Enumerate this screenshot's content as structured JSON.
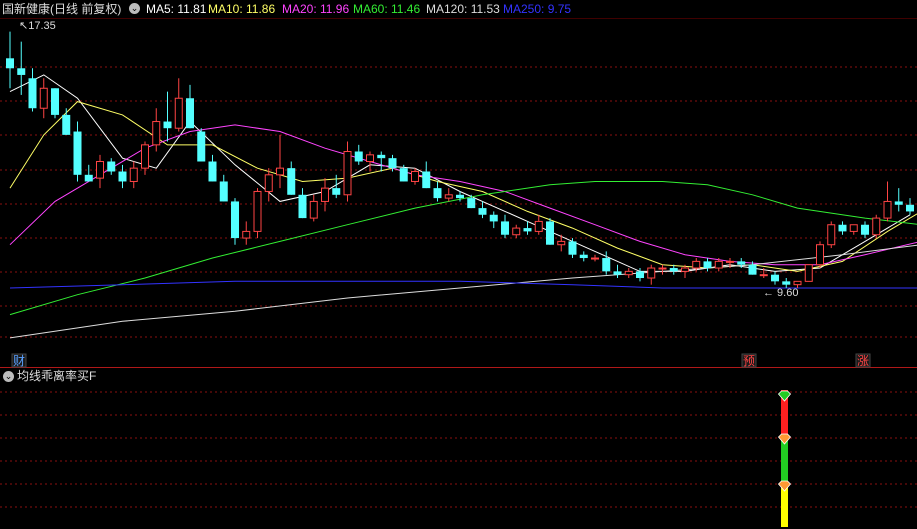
{
  "header": {
    "stock_title": "国新健康(日线 前复权)",
    "indicators": [
      {
        "label": "MA5: 11.81",
        "color": "#ffffff"
      },
      {
        "label": "MA10: 11.86",
        "color": "#ffff66"
      },
      {
        "label": "MA20: 11.96",
        "color": "#ff44ff"
      },
      {
        "label": "MA60: 11.46",
        "color": "#33ee33"
      },
      {
        "label": "MA120: 11.53",
        "color": "#dddddd"
      },
      {
        "label": "MA250: 9.75",
        "color": "#3333ff"
      }
    ]
  },
  "price_chart": {
    "high_label": "17.35",
    "low_label": "9.60",
    "markers": [
      {
        "text": "财",
        "color": "#5aa0ff"
      },
      {
        "text": "预",
        "color": "#ff4444"
      },
      {
        "text": "涨",
        "color": "#ff4444"
      }
    ]
  },
  "sub_panel": {
    "title": "均线乖离率买F",
    "bar_colors": [
      "#ff2020",
      "#22cc22",
      "#ffff00"
    ]
  },
  "colors": {
    "up": "#ff4444",
    "down": "#54ffff",
    "grid": "#8a1010",
    "background": "#000000"
  },
  "chart_data": {
    "type": "candlestick",
    "price_max": 17.35,
    "price_min": 9.6,
    "candles": [
      [
        16.5,
        17.3,
        15.6,
        16.2
      ],
      [
        16.2,
        17.0,
        15.4,
        16.0
      ],
      [
        15.9,
        16.2,
        14.9,
        15.0
      ],
      [
        15.0,
        15.9,
        14.7,
        15.6
      ],
      [
        15.6,
        15.6,
        14.7,
        14.8
      ],
      [
        14.8,
        15.0,
        14.2,
        14.2
      ],
      [
        14.3,
        14.6,
        12.8,
        13.0
      ],
      [
        13.0,
        13.3,
        12.8,
        12.8
      ],
      [
        12.9,
        13.6,
        12.6,
        13.4
      ],
      [
        13.4,
        13.5,
        13.0,
        13.1
      ],
      [
        13.1,
        13.3,
        12.6,
        12.8
      ],
      [
        12.8,
        13.4,
        12.6,
        13.2
      ],
      [
        13.2,
        14.0,
        13.0,
        13.9
      ],
      [
        13.9,
        15.0,
        13.7,
        14.6
      ],
      [
        14.6,
        15.5,
        14.0,
        14.4
      ],
      [
        14.4,
        15.9,
        14.3,
        15.3
      ],
      [
        15.3,
        15.7,
        14.4,
        14.4
      ],
      [
        14.3,
        14.4,
        13.4,
        13.4
      ],
      [
        13.4,
        13.6,
        12.8,
        12.8
      ],
      [
        12.8,
        13.0,
        12.2,
        12.2
      ],
      [
        12.2,
        12.3,
        10.9,
        11.1
      ],
      [
        11.1,
        11.6,
        10.9,
        11.3
      ],
      [
        11.3,
        12.6,
        11.1,
        12.5
      ],
      [
        12.5,
        13.2,
        12.2,
        13.0
      ],
      [
        13.0,
        14.2,
        12.6,
        13.2
      ],
      [
        13.2,
        13.4,
        12.4,
        12.4
      ],
      [
        12.4,
        12.6,
        11.7,
        11.7
      ],
      [
        11.7,
        12.4,
        11.6,
        12.2
      ],
      [
        12.2,
        12.9,
        11.9,
        12.6
      ],
      [
        12.6,
        13.0,
        12.3,
        12.4
      ],
      [
        12.4,
        14.0,
        12.2,
        13.7
      ],
      [
        13.7,
        13.9,
        13.3,
        13.4
      ],
      [
        13.4,
        13.7,
        13.1,
        13.6
      ],
      [
        13.6,
        13.7,
        13.1,
        13.5
      ],
      [
        13.5,
        13.6,
        13.1,
        13.2
      ],
      [
        13.2,
        13.3,
        12.8,
        12.8
      ],
      [
        12.8,
        13.2,
        12.7,
        13.1
      ],
      [
        13.1,
        13.4,
        12.6,
        12.6
      ],
      [
        12.6,
        12.8,
        12.2,
        12.3
      ],
      [
        12.3,
        12.6,
        12.2,
        12.4
      ],
      [
        12.4,
        12.5,
        12.2,
        12.3
      ],
      [
        12.3,
        12.4,
        12.0,
        12.0
      ],
      [
        12.0,
        12.2,
        11.7,
        11.8
      ],
      [
        11.8,
        11.9,
        11.4,
        11.6
      ],
      [
        11.6,
        11.8,
        11.1,
        11.2
      ],
      [
        11.2,
        11.5,
        11.1,
        11.4
      ],
      [
        11.4,
        11.6,
        11.2,
        11.3
      ],
      [
        11.3,
        11.8,
        11.2,
        11.6
      ],
      [
        11.6,
        11.7,
        10.9,
        10.9
      ],
      [
        10.9,
        11.2,
        10.7,
        11.0
      ],
      [
        11.0,
        11.1,
        10.5,
        10.6
      ],
      [
        10.6,
        10.7,
        10.4,
        10.5
      ],
      [
        10.5,
        10.6,
        10.4,
        10.5
      ],
      [
        10.5,
        10.7,
        10.0,
        10.1
      ],
      [
        10.1,
        10.3,
        9.9,
        10.0
      ],
      [
        10.0,
        10.2,
        9.9,
        10.1
      ],
      [
        10.1,
        10.2,
        9.8,
        9.9
      ],
      [
        9.9,
        10.3,
        9.7,
        10.2
      ],
      [
        10.2,
        10.3,
        10.0,
        10.2
      ],
      [
        10.2,
        10.3,
        10.0,
        10.1
      ],
      [
        10.1,
        10.3,
        9.9,
        10.2
      ],
      [
        10.2,
        10.5,
        10.1,
        10.4
      ],
      [
        10.4,
        10.5,
        10.1,
        10.2
      ],
      [
        10.2,
        10.5,
        10.1,
        10.4
      ],
      [
        10.4,
        10.5,
        10.2,
        10.4
      ],
      [
        10.4,
        10.5,
        10.2,
        10.3
      ],
      [
        10.3,
        10.4,
        10.0,
        10.0
      ],
      [
        10.0,
        10.2,
        9.9,
        10.0
      ],
      [
        10.0,
        10.1,
        9.7,
        9.8
      ],
      [
        9.8,
        9.9,
        9.6,
        9.7
      ],
      [
        9.7,
        9.8,
        9.6,
        9.8
      ],
      [
        9.8,
        10.3,
        9.8,
        10.3
      ],
      [
        10.3,
        11.0,
        10.2,
        10.9
      ],
      [
        10.9,
        11.6,
        10.8,
        11.5
      ],
      [
        11.5,
        11.6,
        11.2,
        11.3
      ],
      [
        11.3,
        11.5,
        11.2,
        11.5
      ],
      [
        11.5,
        11.6,
        11.1,
        11.2
      ],
      [
        11.2,
        11.8,
        11.1,
        11.7
      ],
      [
        11.7,
        12.8,
        11.6,
        12.2
      ],
      [
        12.2,
        12.6,
        11.9,
        12.1
      ],
      [
        12.1,
        12.3,
        11.8,
        11.9
      ]
    ],
    "ma_series": [
      {
        "name": "MA5",
        "color": "#ffffff",
        "points": [
          [
            0,
            15.5
          ],
          [
            3,
            16.0
          ],
          [
            6,
            15.3
          ],
          [
            10,
            13.5
          ],
          [
            13,
            13.2
          ],
          [
            16,
            14.6
          ],
          [
            20,
            13.3
          ],
          [
            24,
            12.2
          ],
          [
            28,
            12.5
          ],
          [
            32,
            13.3
          ],
          [
            36,
            13.2
          ],
          [
            40,
            12.5
          ],
          [
            44,
            11.9
          ],
          [
            48,
            11.3
          ],
          [
            52,
            10.7
          ],
          [
            56,
            10.1
          ],
          [
            60,
            10.1
          ],
          [
            64,
            10.3
          ],
          [
            68,
            10.1
          ],
          [
            72,
            10.2
          ],
          [
            76,
            11.0
          ],
          [
            80,
            11.8
          ]
        ]
      },
      {
        "name": "MA10",
        "color": "#ffff66",
        "points": [
          [
            0,
            12.6
          ],
          [
            3,
            14.2
          ],
          [
            6,
            15.2
          ],
          [
            10,
            14.8
          ],
          [
            14,
            13.9
          ],
          [
            18,
            13.9
          ],
          [
            22,
            13.2
          ],
          [
            26,
            12.8
          ],
          [
            30,
            12.9
          ],
          [
            34,
            13.2
          ],
          [
            38,
            12.8
          ],
          [
            42,
            12.5
          ],
          [
            46,
            11.9
          ],
          [
            50,
            11.4
          ],
          [
            54,
            10.8
          ],
          [
            58,
            10.3
          ],
          [
            62,
            10.2
          ],
          [
            66,
            10.3
          ],
          [
            70,
            10.1
          ],
          [
            74,
            10.4
          ],
          [
            78,
            11.3
          ],
          [
            81,
            11.9
          ]
        ]
      },
      {
        "name": "MA20",
        "color": "#ff44ff",
        "points": [
          [
            0,
            10.9
          ],
          [
            4,
            12.2
          ],
          [
            8,
            13.0
          ],
          [
            12,
            13.8
          ],
          [
            16,
            14.3
          ],
          [
            20,
            14.5
          ],
          [
            24,
            14.3
          ],
          [
            28,
            13.8
          ],
          [
            32,
            13.4
          ],
          [
            36,
            13.0
          ],
          [
            40,
            12.8
          ],
          [
            44,
            12.5
          ],
          [
            48,
            12.0
          ],
          [
            52,
            11.5
          ],
          [
            56,
            11.0
          ],
          [
            60,
            10.6
          ],
          [
            64,
            10.4
          ],
          [
            68,
            10.3
          ],
          [
            72,
            10.3
          ],
          [
            76,
            10.6
          ],
          [
            81,
            11.0
          ]
        ]
      },
      {
        "name": "MA60",
        "color": "#33ee33",
        "points": [
          [
            0,
            8.8
          ],
          [
            6,
            9.4
          ],
          [
            12,
            9.9
          ],
          [
            18,
            10.5
          ],
          [
            24,
            11.0
          ],
          [
            30,
            11.5
          ],
          [
            36,
            12.0
          ],
          [
            42,
            12.4
          ],
          [
            48,
            12.7
          ],
          [
            52,
            12.8
          ],
          [
            58,
            12.8
          ],
          [
            62,
            12.7
          ],
          [
            66,
            12.4
          ],
          [
            70,
            12.0
          ],
          [
            76,
            11.7
          ],
          [
            81,
            11.5
          ]
        ]
      },
      {
        "name": "MA120",
        "color": "#dddddd",
        "points": [
          [
            0,
            8.1
          ],
          [
            10,
            8.6
          ],
          [
            20,
            8.9
          ],
          [
            30,
            9.3
          ],
          [
            40,
            9.6
          ],
          [
            50,
            9.9
          ],
          [
            58,
            10.1
          ],
          [
            66,
            10.3
          ],
          [
            74,
            10.6
          ],
          [
            81,
            10.9
          ]
        ]
      },
      {
        "name": "MA250",
        "color": "#3333ff",
        "points": [
          [
            0,
            9.6
          ],
          [
            10,
            9.7
          ],
          [
            20,
            9.8
          ],
          [
            30,
            9.8
          ],
          [
            40,
            9.8
          ],
          [
            50,
            9.7
          ],
          [
            58,
            9.6
          ],
          [
            66,
            9.6
          ],
          [
            74,
            9.6
          ],
          [
            81,
            9.6
          ]
        ]
      }
    ]
  }
}
